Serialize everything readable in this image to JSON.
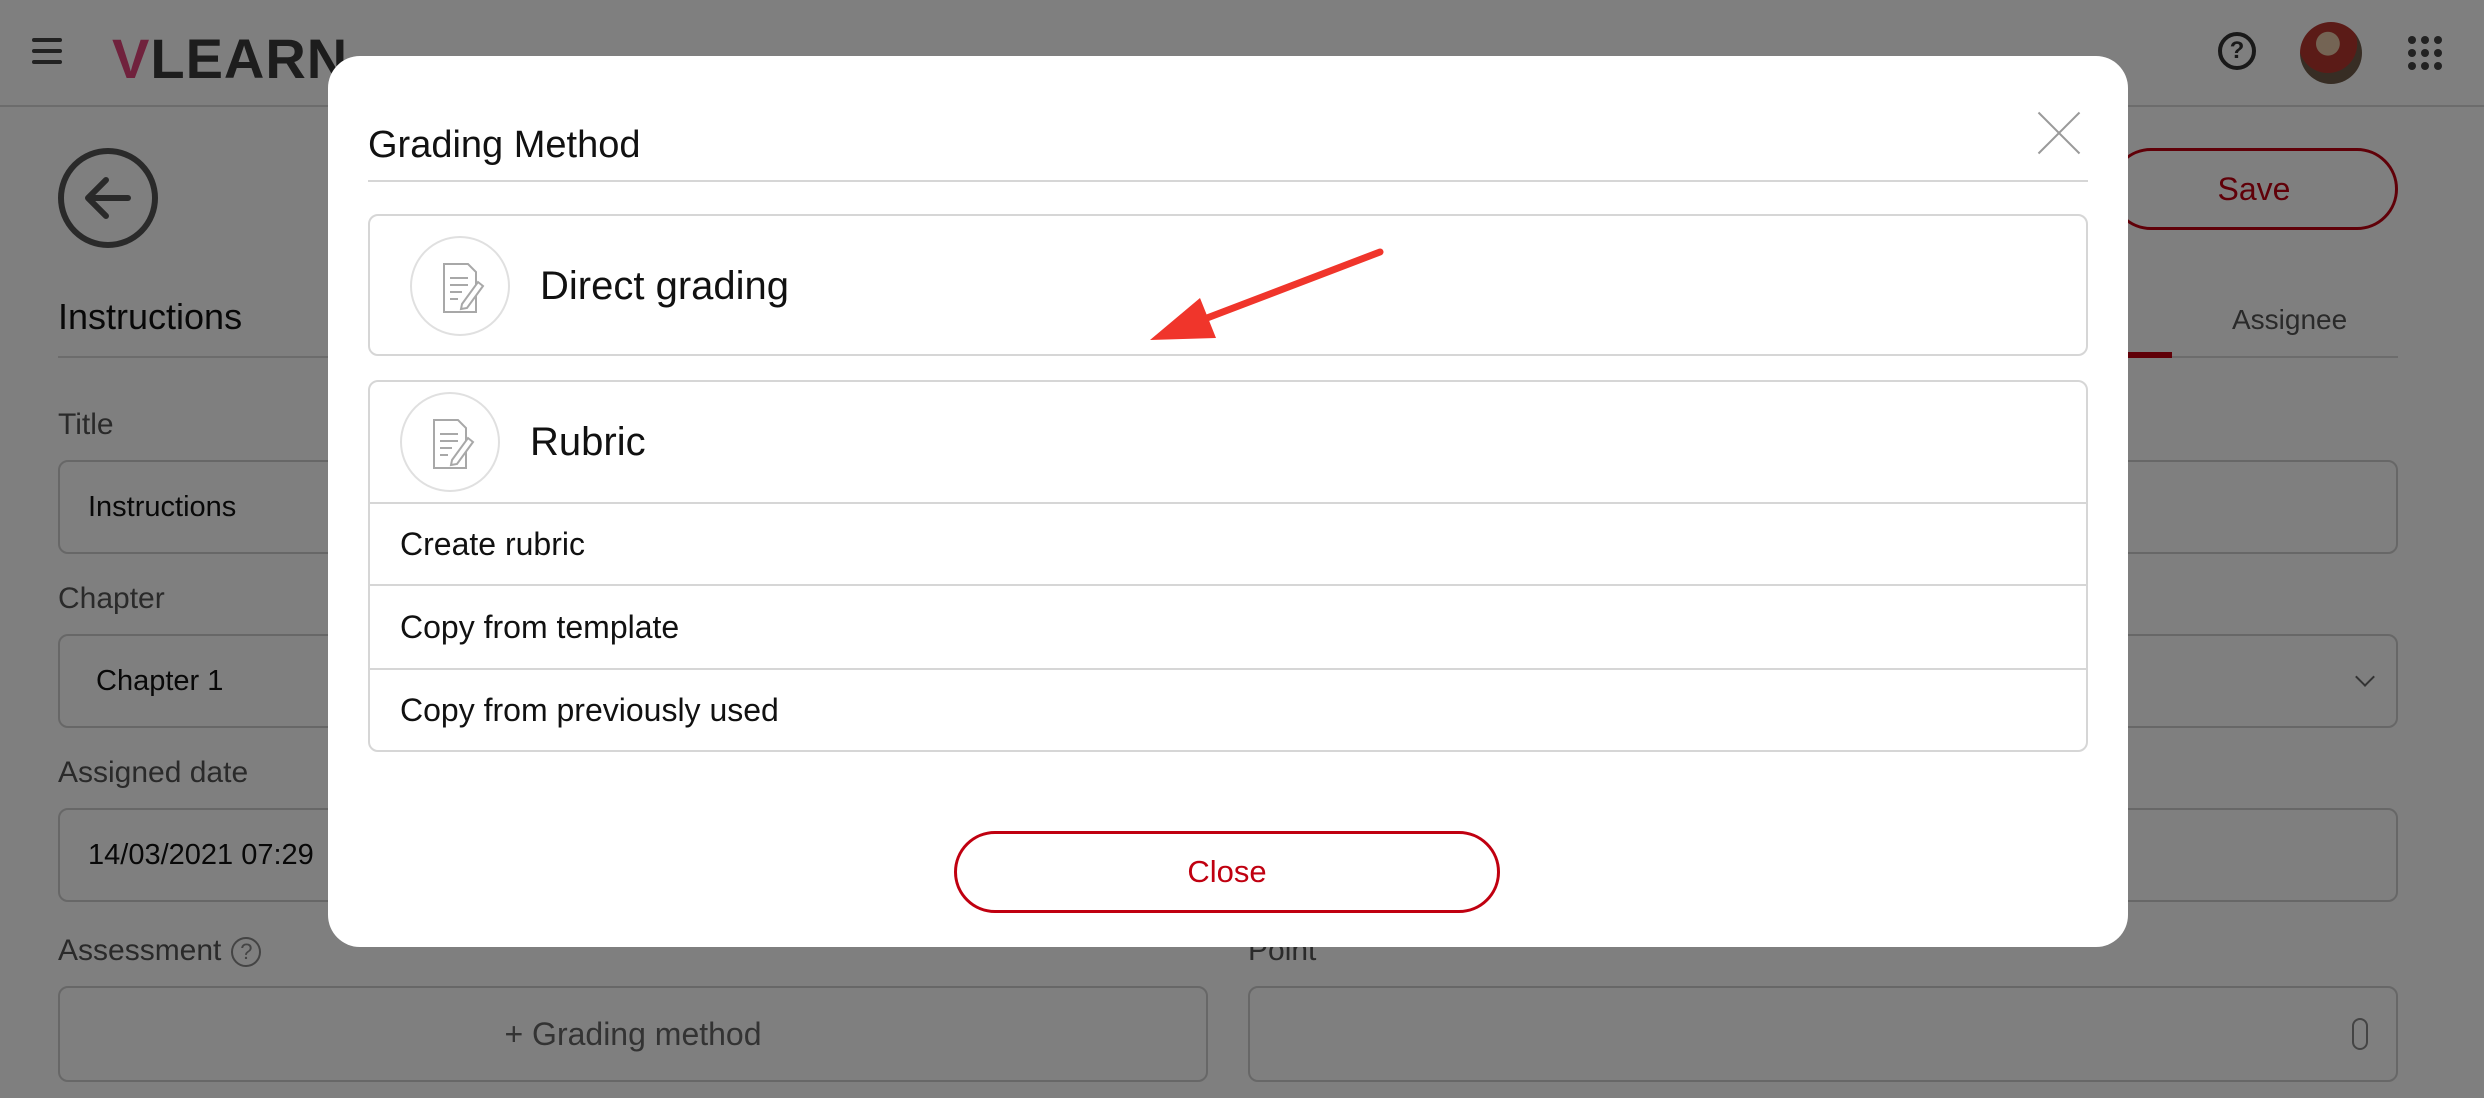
{
  "app": {
    "logo_text_first": "V",
    "logo_text_rest": "LEARN",
    "help_glyph": "?"
  },
  "header": {
    "save_label": "Save"
  },
  "form": {
    "section_title": "Instructions",
    "tab_assignee": "Assignee",
    "title_label": "Title",
    "title_value": "Instructions",
    "chapter_label": "Chapter",
    "chapter_value": "Chapter 1",
    "assigned_date_label": "Assigned date",
    "assigned_date_value": "14/03/2021 07:29",
    "assessment_label": "Assessment",
    "assessment_help_glyph": "?",
    "point_label": "Point",
    "grading_method_button": "+ Grading method"
  },
  "modal": {
    "title": "Grading Method",
    "direct_grading_label": "Direct grading",
    "rubric_label": "Rubric",
    "rubric_options": [
      "Create rubric",
      "Copy from template",
      "Copy from previously used"
    ],
    "close_label": "Close"
  },
  "colors": {
    "accent": "#c00010",
    "annotation_arrow": "#f0352b"
  },
  "icons": {
    "menu": "hamburger-icon",
    "help": "help-icon",
    "apps": "apps-grid-icon",
    "back": "arrow-left-icon",
    "close": "close-icon",
    "document": "document-edit-icon"
  }
}
